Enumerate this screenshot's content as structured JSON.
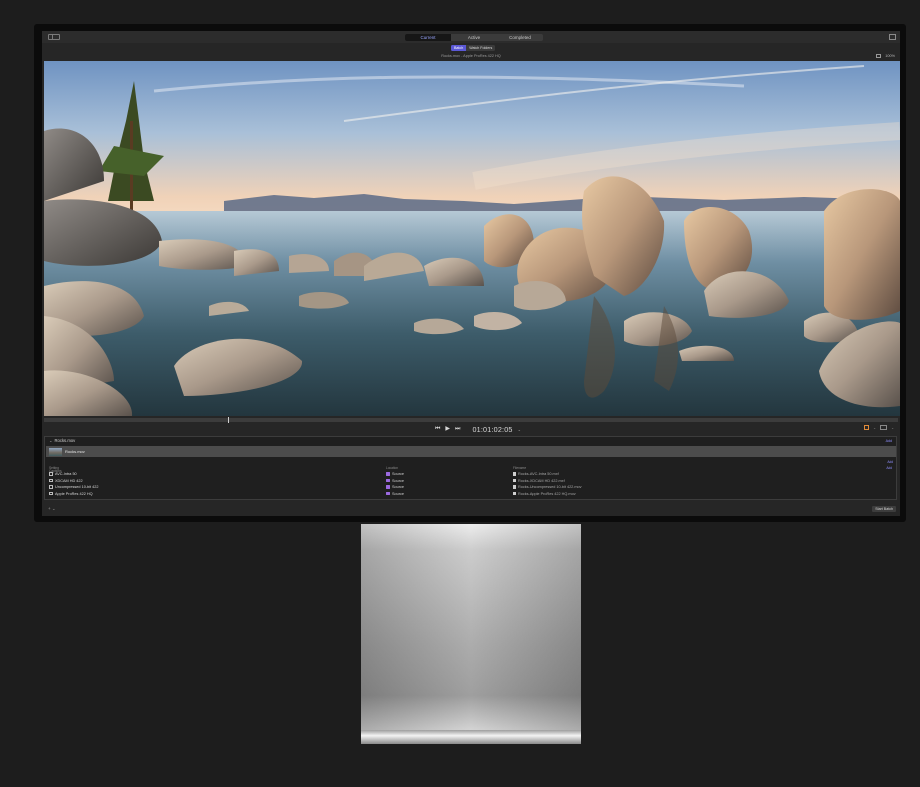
{
  "toolbar": {
    "tabs": [
      {
        "label": "Current",
        "active": true
      },
      {
        "label": "Active",
        "active": false
      },
      {
        "label": "Completed",
        "active": false
      }
    ]
  },
  "mode": {
    "batch_label": "Batch",
    "watch_label": "Watch Folders"
  },
  "viewer": {
    "title": "Rocks.mov - Apple ProRes 422 HQ",
    "zoom": "100%",
    "timecode": "01:01:02:05"
  },
  "batch": {
    "job_name": "Rocks.mov",
    "job_add": "Add",
    "file_name": "Rocks.mov",
    "captions_label": "Captions",
    "captions_add": "Add",
    "columns": {
      "setting": "Setting",
      "location": "Location",
      "filename": "Filename",
      "add": "Add"
    },
    "rows": [
      {
        "setting": "AVC-Intra 50",
        "location": "Source",
        "filename": "Rocks-AVC-Intra 50.mxf"
      },
      {
        "setting": "XDCAM HD 422",
        "location": "Source",
        "filename": "Rocks-XDCAM HD 422.mxf"
      },
      {
        "setting": "Uncompressed 10-bit 422",
        "location": "Source",
        "filename": "Rocks-Uncompressed 10-bit 422.mov"
      },
      {
        "setting": "Apple ProRes 422 HQ",
        "location": "Source",
        "filename": "Rocks-Apple ProRes 422 HQ.mov"
      }
    ],
    "footer_left": "+ ⌄",
    "start_button": "Start Batch"
  },
  "colors": {
    "accent": "#5b58d6",
    "link": "#8f8fff",
    "folder": "#9c6ae0",
    "tag": "#e08a3a"
  }
}
